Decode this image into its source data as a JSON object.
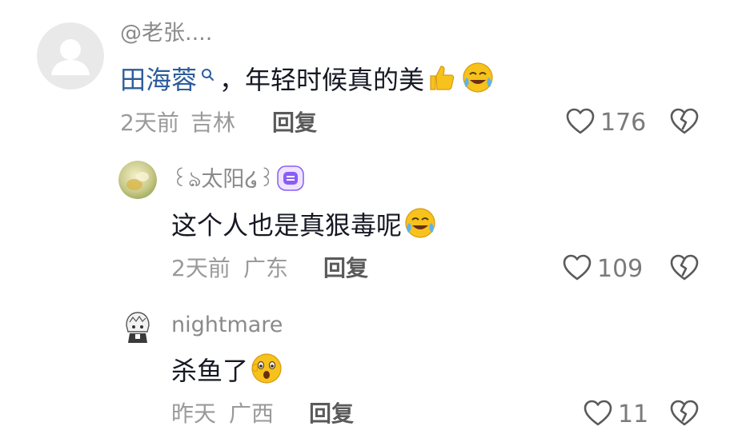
{
  "comment": {
    "username": "@老张....",
    "mention": "田海蓉",
    "text": "，年轻时候真的美",
    "time": "2天前",
    "location": "吉林",
    "reply_label": "回复",
    "likes": "176"
  },
  "replies": [
    {
      "username": "꒰ঌ太阳໒꒱",
      "text": "这个人也是真狠毒呢",
      "time": "2天前",
      "location": "广东",
      "reply_label": "回复",
      "likes": "109"
    },
    {
      "username": "nightmare",
      "text": "杀鱼了",
      "time": "昨天",
      "location": "广西",
      "reply_label": "回复",
      "likes": "11"
    }
  ],
  "colors": {
    "mention": "#2d5d9c",
    "badge": "#8b5cf6",
    "emoji": "#f6c21c"
  }
}
